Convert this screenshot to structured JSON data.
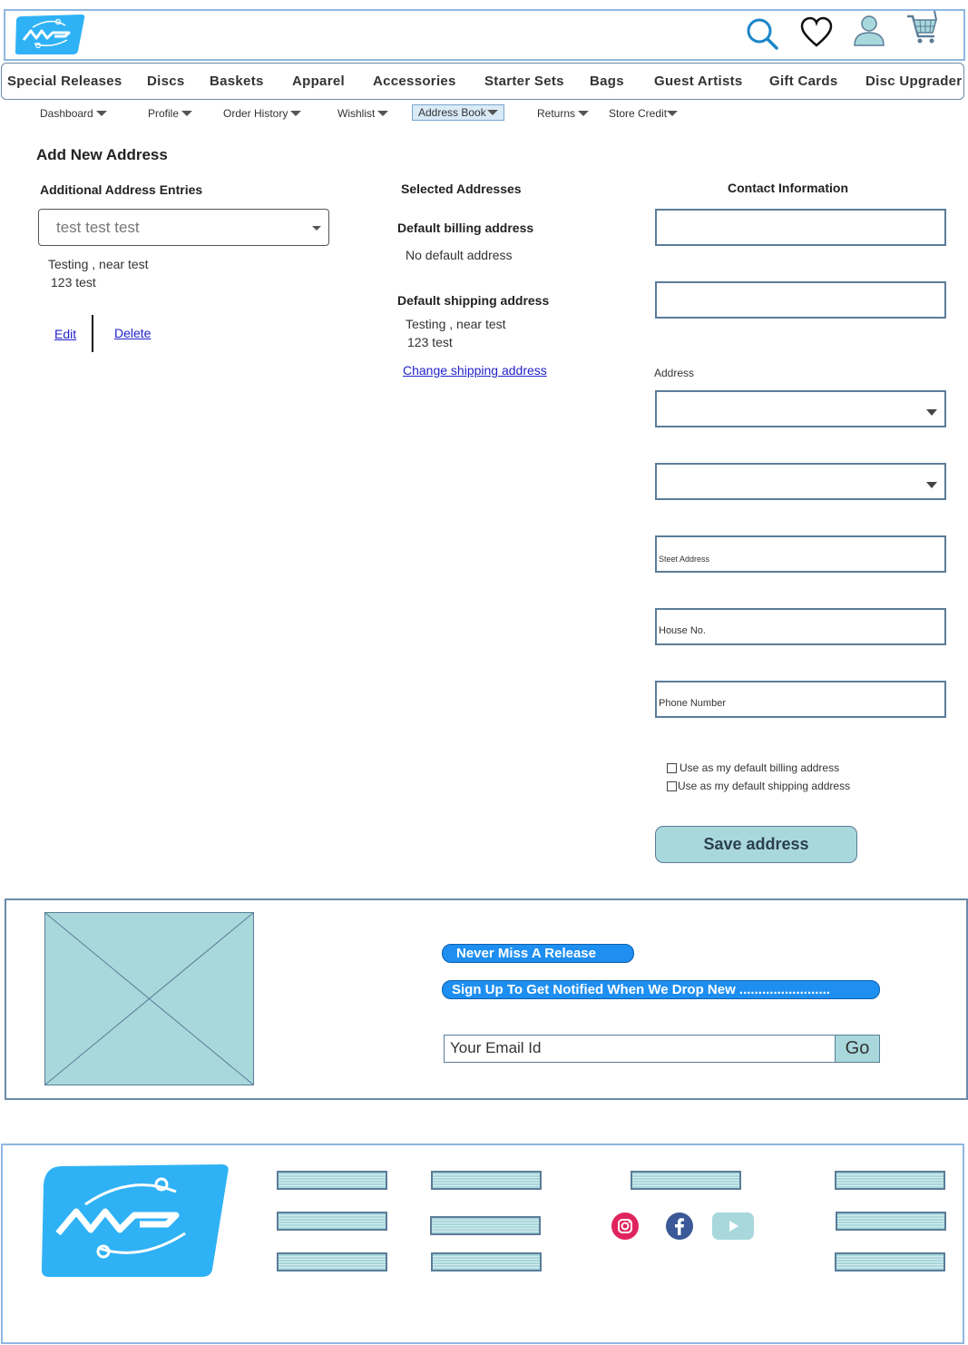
{
  "header": {
    "icons": [
      "search-icon",
      "heart-icon",
      "user-icon",
      "cart-icon"
    ]
  },
  "nav": {
    "items": [
      "Special Releases",
      "Discs",
      "Baskets",
      "Apparel",
      "Accessories",
      "Starter Sets",
      "Bags",
      "Guest Artists",
      "Gift Cards",
      "Disc Upgrader"
    ]
  },
  "subnav": {
    "items": [
      "Dashboard",
      "Profile",
      "Order History",
      "Wishlist",
      "Address Book",
      "Returns",
      "Store Credit"
    ],
    "active": "Address Book"
  },
  "page": {
    "title": "Add New Address"
  },
  "additional": {
    "heading": "Additional Address Entries",
    "selected_value": "test test test",
    "address_line1": "Testing , near test",
    "address_line2": "123 test",
    "edit_label": "Edit",
    "delete_label": "Delete"
  },
  "selected": {
    "heading": "Selected Addresses",
    "billing_heading": "Default billing address",
    "billing_value": "No default address",
    "shipping_heading": "Default shipping address",
    "shipping_line1": "Testing , near test",
    "shipping_line2": "123 test",
    "change_link": "Change shipping address"
  },
  "contact": {
    "heading": "Contact Information",
    "address_label": "Address",
    "street_placeholder": "Steet Address",
    "house_placeholder": "House No.",
    "phone_placeholder": "Phone Number",
    "default_billing": "Use as my default billing address",
    "default_shipping": "Use as my default shipping address",
    "save_label": "Save address"
  },
  "newsletter": {
    "pill1": "Never Miss A Release",
    "pill2": "Sign Up To Get Notified When We Drop New ........................",
    "email_placeholder": "Your Email Id",
    "go_label": "Go"
  },
  "colors": {
    "brand_blue": "#2fb2f5",
    "accent_teal": "#a8d8dc",
    "pill_blue": "#1e8ff0",
    "border": "#5b7c98"
  }
}
